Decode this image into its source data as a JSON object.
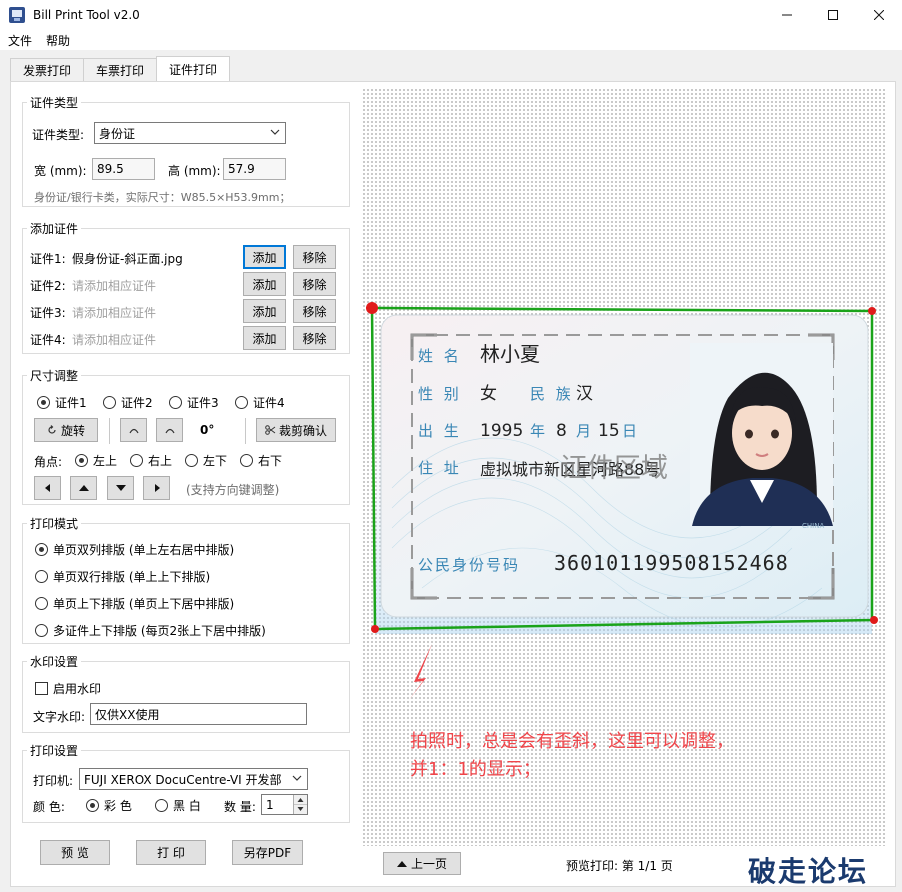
{
  "window": {
    "title": "Bill Print Tool v2.0"
  },
  "menu": [
    "文件",
    "帮助"
  ],
  "tabs": [
    "发票打印",
    "车票打印",
    "证件打印"
  ],
  "cert_type": {
    "group_title": "证件类型",
    "type_label": "证件类型:",
    "type_value": "身份证",
    "width_label": "宽 (mm):",
    "width_value": "89.5",
    "height_label": "高 (mm):",
    "height_value": "57.9",
    "hint": "身份证/银行卡类，实际尺寸：W85.5×H53.9mm；"
  },
  "add_cert": {
    "group_title": "添加证件",
    "add_label": "添加",
    "remove_label": "移除",
    "rows": [
      {
        "label": "证件1:",
        "value": "假身份证-斜正面.jpg",
        "placeholder": false
      },
      {
        "label": "证件2:",
        "value": "请添加相应证件",
        "placeholder": true
      },
      {
        "label": "证件3:",
        "value": "请添加相应证件",
        "placeholder": true
      },
      {
        "label": "证件4:",
        "value": "请添加相应证件",
        "placeholder": true
      }
    ]
  },
  "size_adjust": {
    "group_title": "尺寸调整",
    "cert_options": [
      "证件1",
      "证件2",
      "证件3",
      "证件4"
    ],
    "cert_selected": "证件1",
    "rotate_label": "旋转",
    "angle_value": "0°",
    "crop_confirm_label": "裁剪确认",
    "corner_label": "角点:",
    "corner_options": [
      "左上",
      "右上",
      "左下",
      "右下"
    ],
    "corner_selected": "左上",
    "arrow_hint": "(支持方向键调整)"
  },
  "print_mode": {
    "group_title": "打印模式",
    "options": [
      "单页双列排版 (单上左右居中排版)",
      "单页双行排版 (单上上下排版)",
      "单页上下排版 (单页上下居中排版)",
      "多证件上下排版 (每页2张上下居中排版)"
    ],
    "selected_index": 0
  },
  "watermark": {
    "group_title": "水印设置",
    "enable_label": "启用水印",
    "enabled": false,
    "text_label": "文字水印:",
    "text_value": "仅供XX使用"
  },
  "print_settings": {
    "group_title": "打印设置",
    "printer_label": "打印机:",
    "printer_value": "FUJI XEROX DocuCentre-VI 开发部",
    "color_label": "颜  色:",
    "color_options": [
      "彩 色",
      "黑 白"
    ],
    "color_selected": "彩 色",
    "qty_label": "数 量:",
    "qty_value": "1"
  },
  "bottom_buttons": {
    "preview": "预 览",
    "print": "打 印",
    "save_pdf": "另存PDF"
  },
  "preview": {
    "prev_page_label": "上一页",
    "status": "预览打印: 第 1/1 页",
    "annotation": [
      "拍照时，总是会有歪斜，这里可以调整，",
      "并1：1的显示；"
    ],
    "card": {
      "name_label": "姓 名",
      "name_value": "林小夏",
      "sex_label": "性 别",
      "sex_value": "女",
      "nation_label": "民 族",
      "nation_value": "汉",
      "birth_label": "出 生",
      "birth_year": "1995",
      "birth_year_unit": "年",
      "birth_month": "8",
      "birth_month_unit": "月",
      "birth_day": "15",
      "birth_day_unit": "日",
      "address_label": "住 址",
      "address_value": "虚拟城市新区星河路88号",
      "id_label": "公民身份号码",
      "id_value": "360101199508152468",
      "overlay_text": "证件区域",
      "china_text": "CHINA"
    }
  },
  "watermark_logo": "破走论坛",
  "colors": {
    "selection_green": "#1aa31a",
    "handle_red": "#e01a1a",
    "annotation_red": "#f0454a"
  }
}
